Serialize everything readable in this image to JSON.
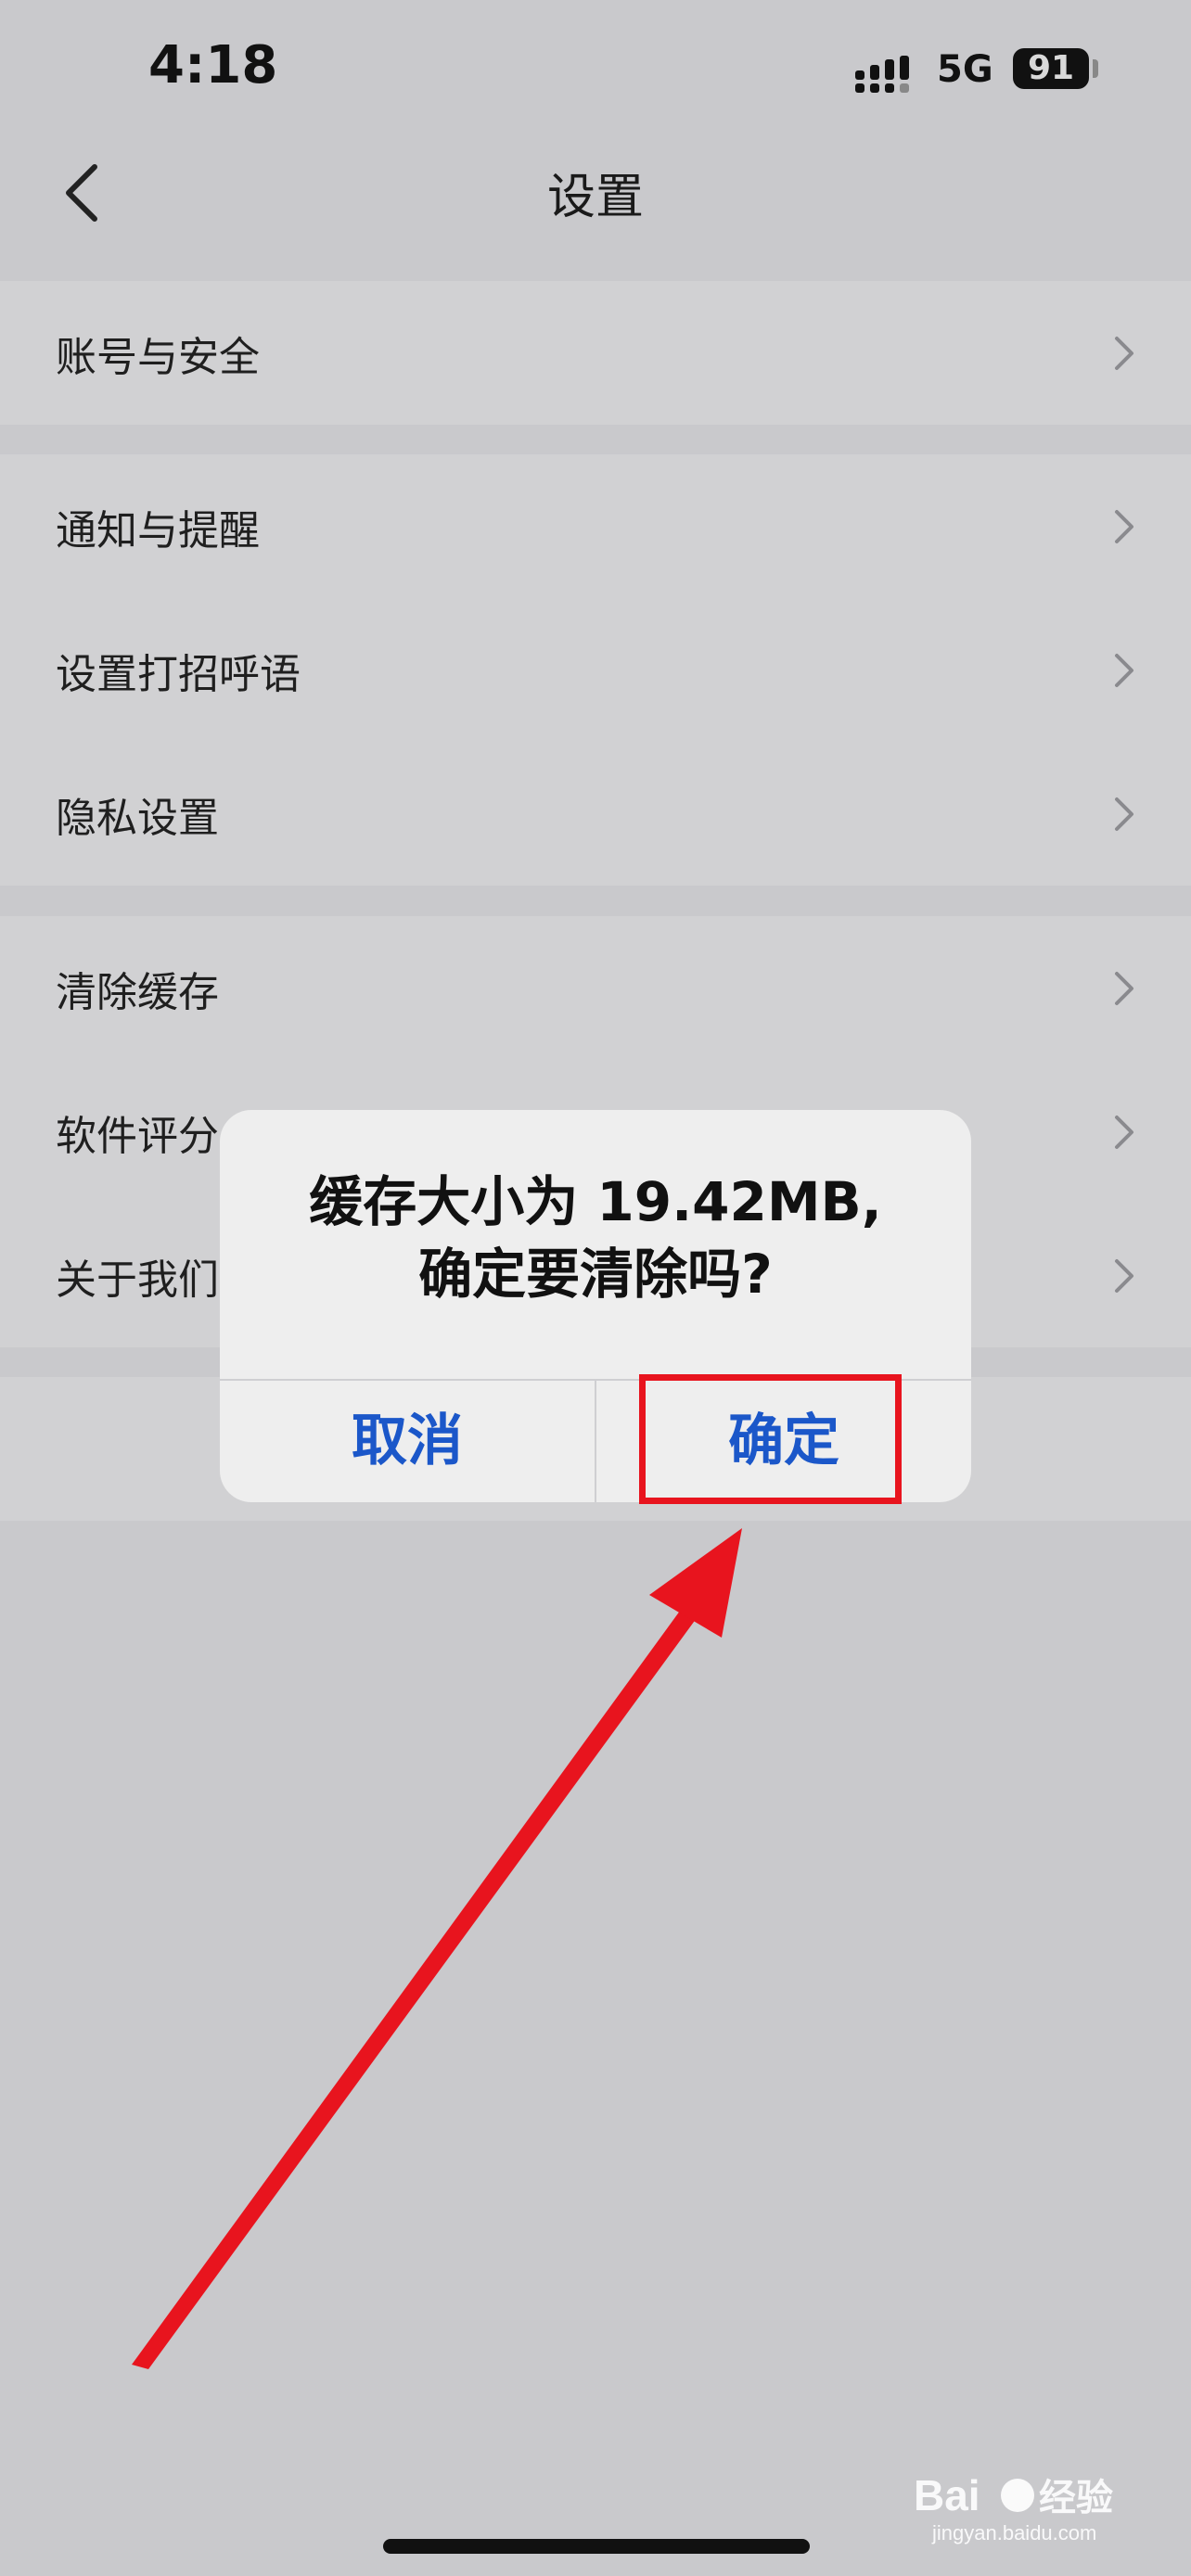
{
  "status_bar": {
    "time": "4:18",
    "network": "5G",
    "battery": "91"
  },
  "header": {
    "title": "设置"
  },
  "settings": {
    "items": [
      {
        "label": "账号与安全"
      },
      {
        "label": "通知与提醒"
      },
      {
        "label": "设置打招呼语"
      },
      {
        "label": "隐私设置"
      },
      {
        "label": "清除缓存"
      },
      {
        "label": "软件评分"
      },
      {
        "label": "关于我们"
      }
    ]
  },
  "alert": {
    "message_line1": "缓存大小为 19.42MB,",
    "message_line2": "确定要清除吗?",
    "cancel_label": "取消",
    "confirm_label": "确定"
  },
  "colors": {
    "highlight": "#e8141e",
    "button_text": "#1b57c9"
  },
  "watermark": {
    "brand": "Baidu经验",
    "url": "jingyan.baidu.com"
  }
}
